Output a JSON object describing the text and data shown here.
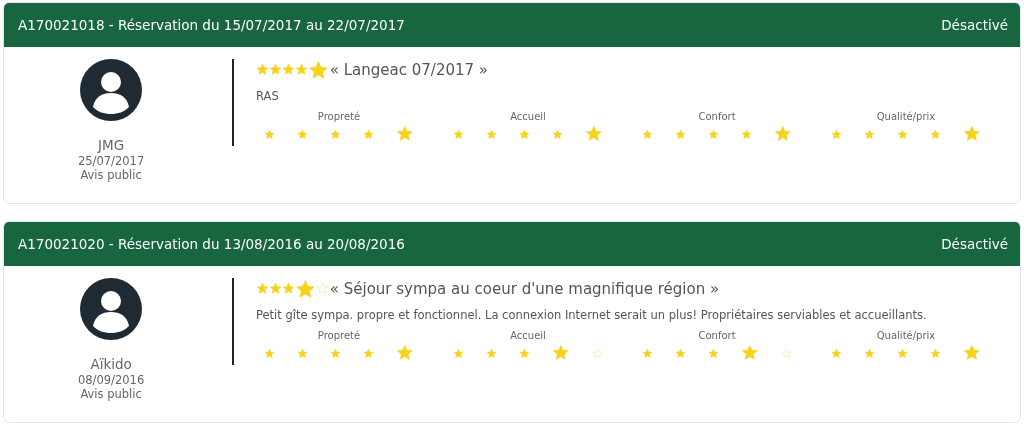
{
  "reviews": [
    {
      "header": "A170021018 - Réservation du 15/07/2017 au 22/07/2017",
      "status": "Désactivé",
      "author": "JMG",
      "date": "25/07/2017",
      "visibility": "Avis public",
      "stars": 5,
      "title": "« Langeac 07/2017 »",
      "text": "RAS",
      "categories": [
        {
          "label": "Propreté",
          "stars": 5
        },
        {
          "label": "Accueil",
          "stars": 5
        },
        {
          "label": "Confort",
          "stars": 5
        },
        {
          "label": "Qualité/prix",
          "stars": 5
        }
      ]
    },
    {
      "header": "A170021020 - Réservation du 13/08/2016 au 20/08/2016",
      "status": "Désactivé",
      "author": "Aïkido",
      "date": "08/09/2016",
      "visibility": "Avis public",
      "stars": 4,
      "title": "« Séjour sympa au coeur d'une magnifique région »",
      "text": "Petit gîte sympa. propre et fonctionnel. La connexion Internet serait un plus! Propriétaires serviables et accueillants.",
      "categories": [
        {
          "label": "Propreté",
          "stars": 5
        },
        {
          "label": "Accueil",
          "stars": 4
        },
        {
          "label": "Confort",
          "stars": 4
        },
        {
          "label": "Qualité/prix",
          "stars": 5
        }
      ]
    }
  ]
}
